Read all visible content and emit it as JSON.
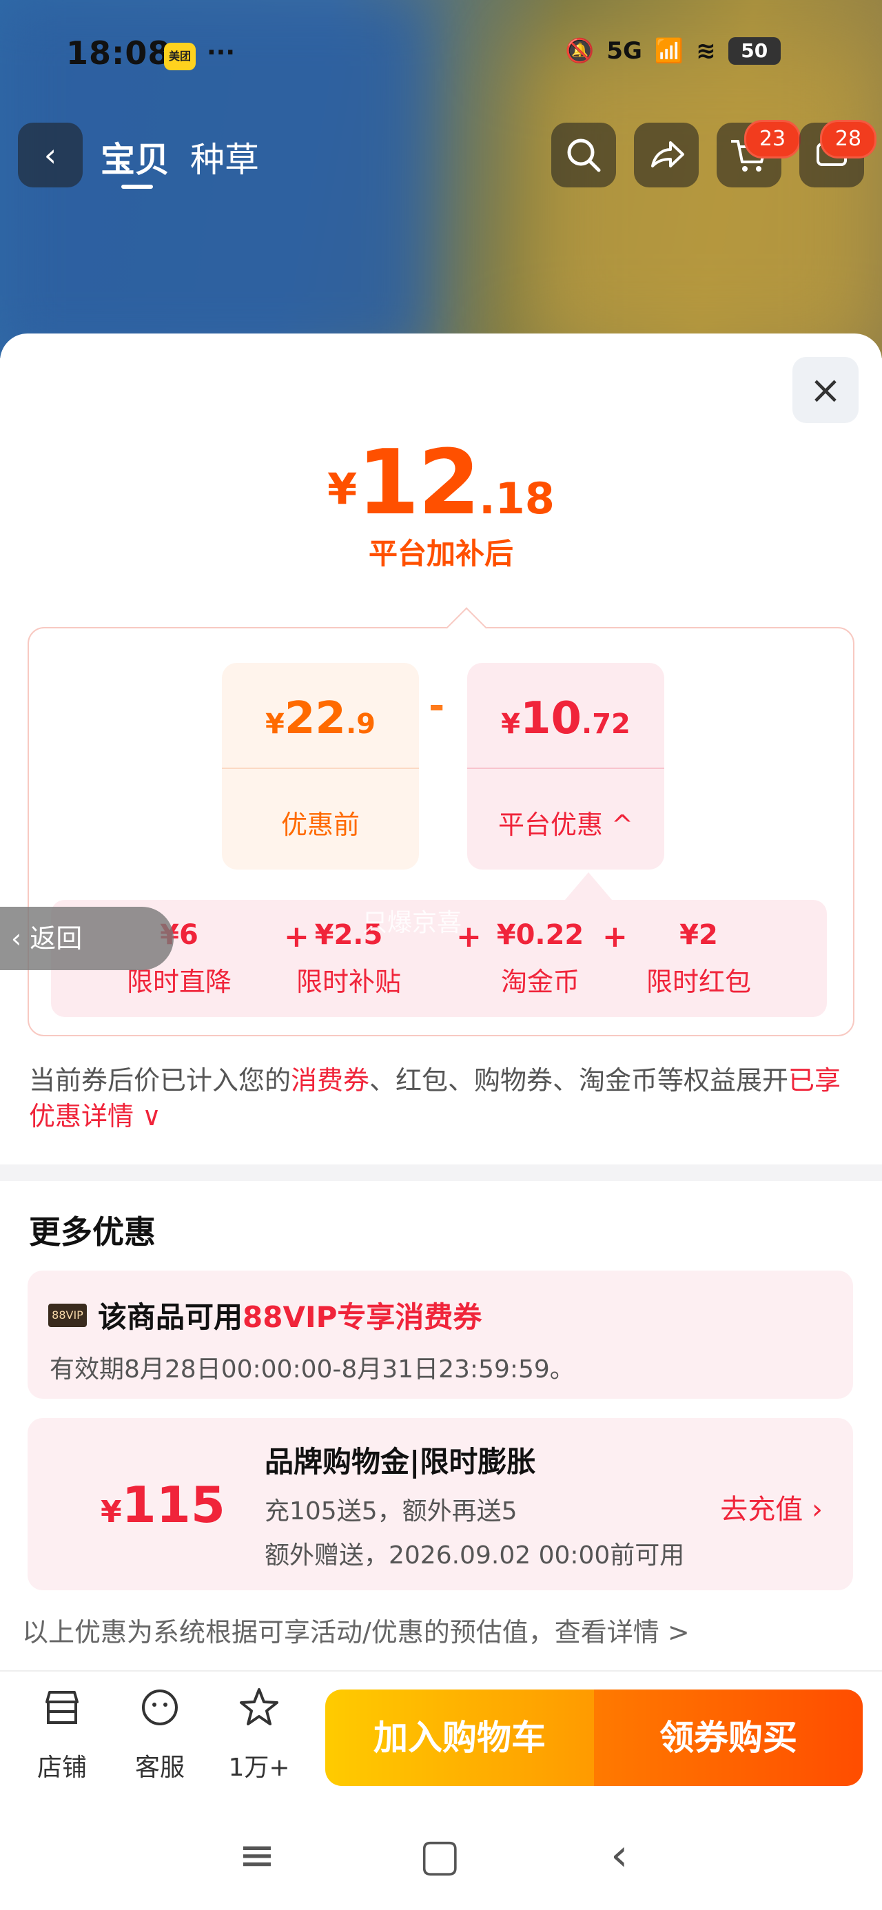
{
  "status_bar": {
    "time": "18:08",
    "app_badge": "美团",
    "more": "···",
    "network": "5G",
    "battery": "50"
  },
  "nav": {
    "back_label": "‹",
    "tabs": [
      {
        "label": "宝贝",
        "active": true
      },
      {
        "label": "种草",
        "active": false
      }
    ],
    "cart_badge": "23",
    "message_badge": "28"
  },
  "sheet": {
    "close_label": "×",
    "final_price": {
      "currency": "¥",
      "integer": "12",
      "decimal": ".18"
    },
    "final_price_label": "平台加补后",
    "before_card": {
      "currency": "¥",
      "integer": "22",
      "decimal": ".9",
      "label": "优惠前"
    },
    "minus": "-",
    "discount_card": {
      "currency": "¥",
      "integer": "10",
      "decimal": ".72",
      "label": "平台优惠",
      "chevron": "^"
    },
    "breakdown": [
      {
        "value": "¥6",
        "label": "限时直降"
      },
      {
        "value": "¥2.5",
        "label": "限时补贴"
      },
      {
        "value": "¥0.22",
        "label": "淘金币"
      },
      {
        "value": "¥2",
        "label": "限时红包"
      }
    ],
    "plus": "+",
    "note": {
      "part1": "当前券后价已计入您的",
      "highlight1": "消费券",
      "part2": "、红包、购物券、淘金币等权益展开",
      "highlight2": "已享优惠详情",
      "chevron": "∨"
    },
    "more_title": "更多优惠",
    "back_float_label": "返回",
    "vip_coupon": {
      "tag": "88VIP",
      "title_prefix": "该商品可用",
      "title_highlight": "88VIP专享消费券",
      "validity": "有效期8月28日00:00:00-8月31日23:59:59。"
    },
    "brand_coupon": {
      "currency": "¥",
      "amount": "115",
      "title": "品牌购物金|限时膨胀",
      "line1": "充105送5，额外再送5",
      "line2": "额外赠送，2026.09.02 00:00前可用",
      "cta": "去充值 ›"
    },
    "footnote": "以上优惠为系统根据可享活动/优惠的预估值，查看详情 >",
    "watermark": "只爆京喜"
  },
  "bottom_bar": {
    "items": [
      {
        "icon": "store-icon",
        "label": "店铺"
      },
      {
        "icon": "service-icon",
        "label": "客服"
      },
      {
        "icon": "star-icon",
        "label": "1万+"
      }
    ],
    "add_cart": "加入购物车",
    "buy": "领券购买"
  },
  "system_nav": {
    "menu": "≡",
    "home": "▢",
    "back": "‹"
  }
}
